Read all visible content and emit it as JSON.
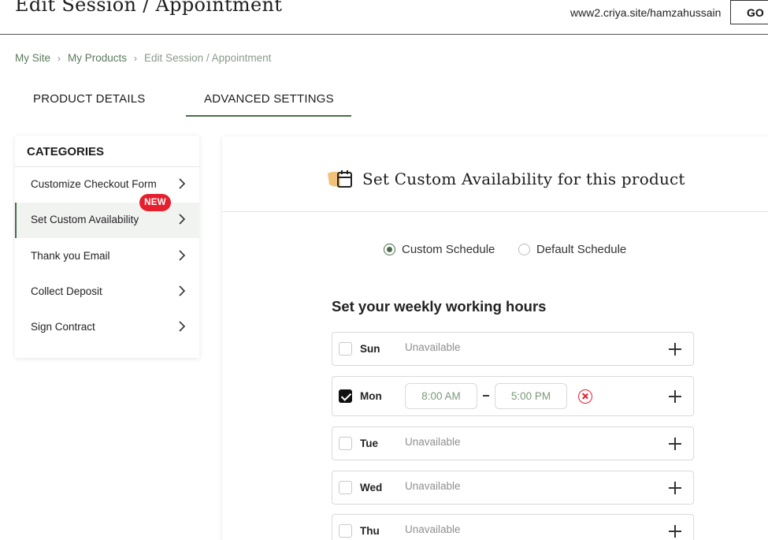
{
  "header": {
    "title": "Edit Session / Appointment",
    "site_url": "www2.criya.site/hamzahussain",
    "go_label": "GO"
  },
  "breadcrumb": {
    "items": [
      "My Site",
      "My Products",
      "Edit Session / Appointment"
    ]
  },
  "tabs": {
    "product_details": "PRODUCT DETAILS",
    "advanced_settings": "ADVANCED SETTINGS",
    "active": "ADVANCED SETTINGS"
  },
  "sidebar": {
    "heading": "CATEGORIES",
    "items": [
      {
        "label": "Customize Checkout Form"
      },
      {
        "label": "Set Custom Availability",
        "badge": "NEW",
        "active": true
      },
      {
        "label": "Thank you Email"
      },
      {
        "label": "Collect Deposit"
      },
      {
        "label": "Sign Contract"
      }
    ]
  },
  "panel": {
    "icon": "calendar-icon",
    "title": "Set Custom Availability for this product",
    "schedule_options": [
      {
        "label": "Custom Schedule",
        "selected": true
      },
      {
        "label": "Default Schedule",
        "selected": false
      }
    ],
    "hours_title": "Set your weekly working hours",
    "days": [
      {
        "name": "Sun",
        "checked": false,
        "status": "Unavailable"
      },
      {
        "name": "Mon",
        "checked": true,
        "start": "8:00 AM",
        "end": "5:00 PM"
      },
      {
        "name": "Tue",
        "checked": false,
        "status": "Unavailable"
      },
      {
        "name": "Wed",
        "checked": false,
        "status": "Unavailable"
      },
      {
        "name": "Thu",
        "checked": false,
        "status": "Unavailable"
      }
    ]
  },
  "colors": {
    "accent": "#4b6b4b",
    "badge": "#e5202e",
    "remove": "#e5202e",
    "icon_highlight": "#f3c27a"
  }
}
